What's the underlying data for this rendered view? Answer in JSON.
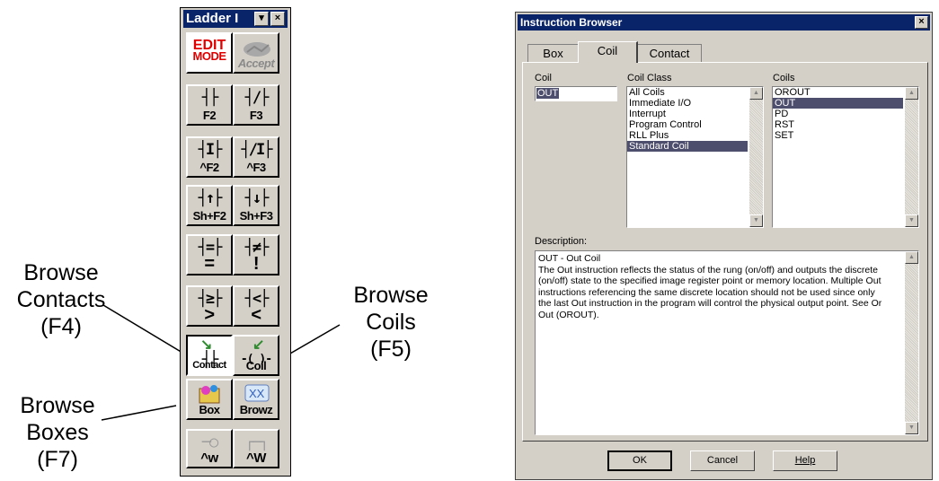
{
  "callouts": {
    "contacts": [
      "Browse",
      "Contacts",
      "(F4)"
    ],
    "coils": [
      "Browse",
      "Coils",
      "(F5)"
    ],
    "boxes": [
      "Browse",
      "Boxes",
      "(F7)"
    ]
  },
  "palette": {
    "title": "Ladder I",
    "buttons": [
      {
        "sym": "EDIT",
        "key": "MODE"
      },
      {
        "sym": "",
        "key": "Accept"
      },
      {
        "sym": "┤├",
        "key": "F2"
      },
      {
        "sym": "┤/├",
        "key": "F3"
      },
      {
        "sym": "┤I├",
        "key": "^F2"
      },
      {
        "sym": "┤/I├",
        "key": "^F3"
      },
      {
        "sym": "┤↑├",
        "key": "Sh+F2"
      },
      {
        "sym": "┤↓├",
        "key": "Sh+F3"
      },
      {
        "sym": "┤=├",
        "key": "="
      },
      {
        "sym": "┤≠├",
        "key": "!"
      },
      {
        "sym": "┤≥├",
        "key": ">"
      },
      {
        "sym": "┤<├",
        "key": "<"
      },
      {
        "sym": "┤├",
        "key": "Contact"
      },
      {
        "sym": "-( )-",
        "key": "Coil"
      },
      {
        "sym": "",
        "key": "Box"
      },
      {
        "sym": "",
        "key": "Browz"
      },
      {
        "sym": "─○",
        "key": "^w"
      },
      {
        "sym": "┌─┐",
        "key": "^W"
      }
    ]
  },
  "dialog": {
    "title": "Instruction Browser",
    "tabs": [
      "Box",
      "Coil",
      "Contact"
    ],
    "active_tab": "Coil",
    "coil_label": "Coil",
    "coil_value": "OUT",
    "coil_class_label": "Coil Class",
    "coil_classes": [
      "All Coils",
      "Immediate I/O",
      "Interrupt",
      "Program Control",
      "RLL Plus",
      "Standard Coil"
    ],
    "selected_class": "Standard Coil",
    "coils_label": "Coils",
    "coils": [
      "OROUT",
      "OUT",
      "PD",
      "RST",
      "SET"
    ],
    "selected_coil": "OUT",
    "description_label": "Description:",
    "description_title": "OUT - Out Coil",
    "description_lines": [
      "The Out instruction reflects the status of the rung (on/off) and outputs the discrete",
      "(on/off) state to the specified image register point or memory location. Multiple Out",
      "instructions referencing the same discrete location should not be used since only",
      "the last Out instruction in the program will control the physical output point. See Or",
      "Out (OROUT)."
    ],
    "ok_label": "OK",
    "cancel_label": "Cancel",
    "help_label": "Help"
  }
}
